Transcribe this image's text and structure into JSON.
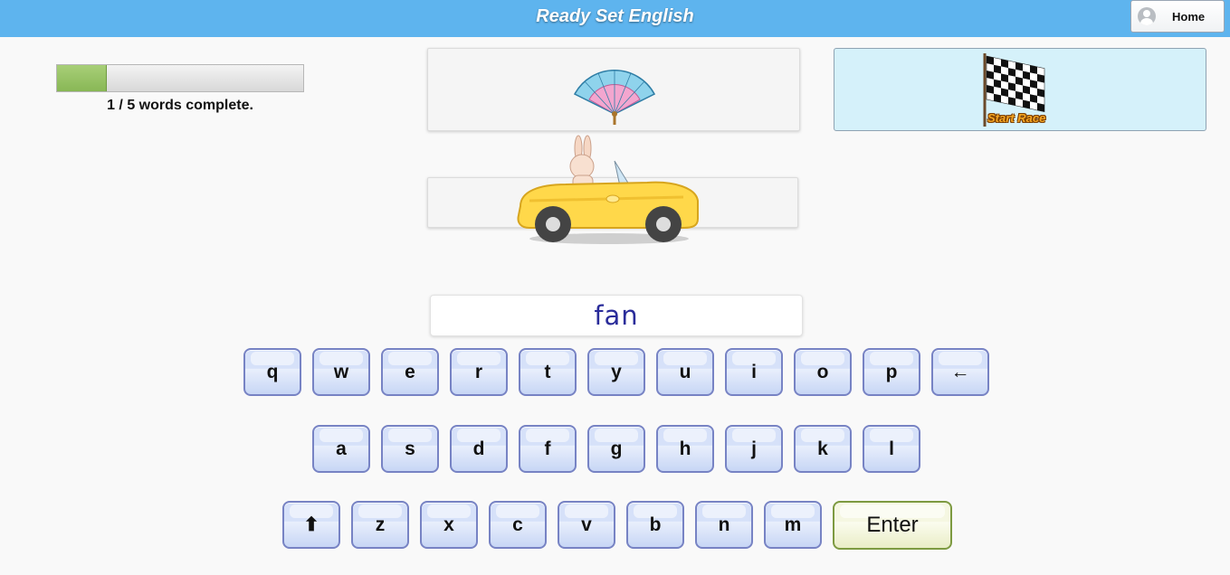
{
  "header": {
    "title": "Ready Set English",
    "home_label": "Home"
  },
  "progress": {
    "completed": 1,
    "total": 5,
    "fraction": 0.2,
    "text": "1 / 5 words complete."
  },
  "picture": {
    "subject": "fan-image"
  },
  "start": {
    "label": "Start Race"
  },
  "answer": {
    "text": "fan"
  },
  "keyboard": {
    "row1": [
      "q",
      "w",
      "e",
      "r",
      "t",
      "y",
      "u",
      "i",
      "o",
      "p",
      "←"
    ],
    "row2": [
      "a",
      "s",
      "d",
      "f",
      "g",
      "h",
      "j",
      "k",
      "l"
    ],
    "row3": [
      "⬆",
      "z",
      "x",
      "c",
      "v",
      "b",
      "n",
      "m"
    ],
    "enter_label": "Enter"
  },
  "colors": {
    "header": "#5eb4ee",
    "answer_text": "#2a2c9a",
    "progress_fill": "#9cc566"
  }
}
